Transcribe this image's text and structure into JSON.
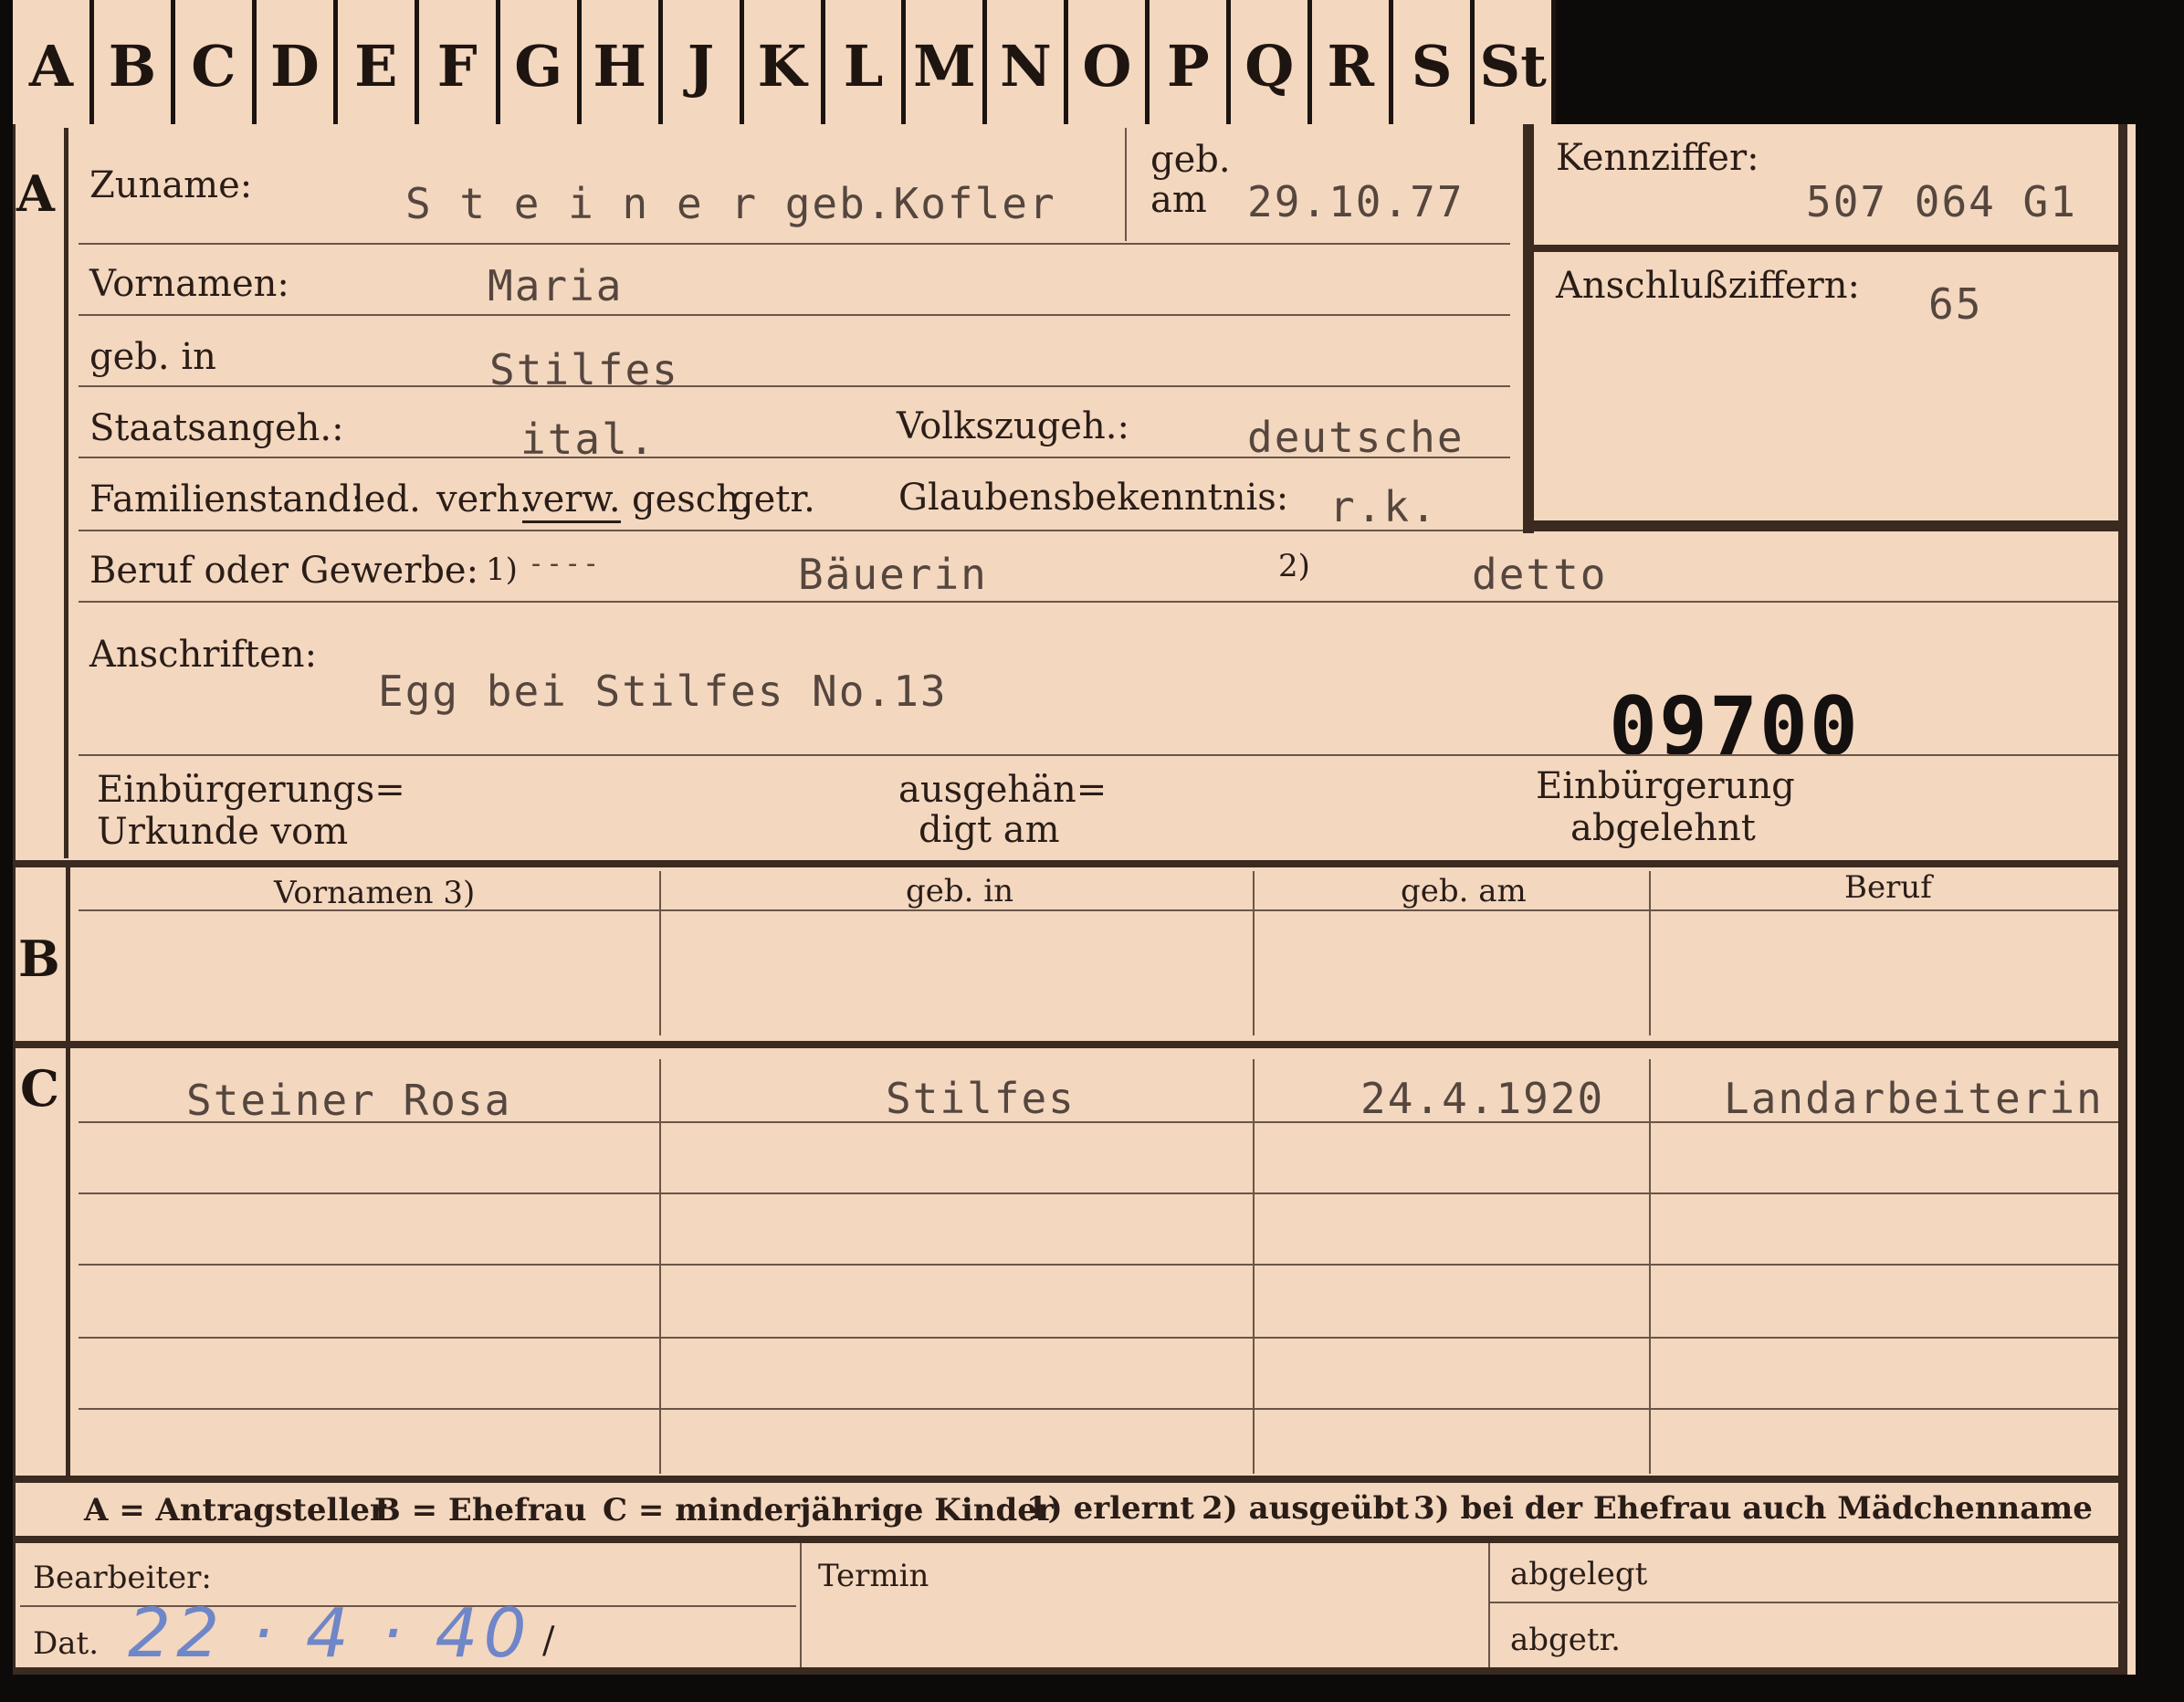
{
  "index_tabs": [
    "A",
    "B",
    "C",
    "D",
    "E",
    "F",
    "G",
    "H",
    "J",
    "K",
    "L",
    "M",
    "N",
    "O",
    "P",
    "Q",
    "R",
    "S",
    "St"
  ],
  "section_a": {
    "marker": "A",
    "surname_label": "Zuname:",
    "surname_value": "S t e i n e r  geb.Kofler",
    "born_label_1": "geb.",
    "born_label_2": "am",
    "born_value": "29.10.77",
    "id_label": "Kennziffer:",
    "id_value": "507 064  G1",
    "link_label": "Anschlußziffern:",
    "link_value": "65",
    "first_names_label": "Vornamen:",
    "first_names_value": "Maria",
    "birthplace_label": "geb. in",
    "birthplace_value": "Stilfes",
    "citizenship_label": "Staatsangeh.:",
    "citizenship_value": "ital.",
    "ethnicity_label": "Volkszugeh.:",
    "ethnicity_value": "deutsche",
    "marital_label": "Familienstand:",
    "marital_options": [
      "led.",
      "verh.",
      "verw.",
      "gesch.",
      "getr."
    ],
    "religion_label": "Glaubensbekenntnis:",
    "religion_value": "r.k.",
    "profession_label": "Beruf oder Gewerbe:",
    "profession_learned_mark": "1)",
    "profession_learned_dash": "----",
    "profession_learned_value": "Bäuerin",
    "profession_practiced_mark": "2)",
    "profession_practiced_value": "detto",
    "address_label": "Anschriften:",
    "address_value": "Egg bei Stilfes No.13",
    "stamp_number": "09700",
    "naturalization_cert_label_1": "Einbürgerungs=",
    "naturalization_cert_label_2": "Urkunde vom",
    "handed_label_1": "ausgehän=",
    "handed_label_2": "digt am",
    "naturalization_denied_label_1": "Einbürgerung",
    "naturalization_denied_label_2": "abgelehnt"
  },
  "section_b": {
    "marker": "B",
    "columns": [
      "Vornamen 3)",
      "geb. in",
      "geb. am",
      "Beruf"
    ]
  },
  "section_c": {
    "marker": "C",
    "rows": [
      {
        "name": "Steiner Rosa",
        "birthplace": "Stilfes",
        "birthdate": "24.4.1920",
        "profession": "Landarbeiterin"
      }
    ]
  },
  "legend": {
    "a": "A = Antragsteller",
    "b": "B = Ehefrau",
    "c": "C = minderjährige Kinder",
    "n1": "1) erlernt",
    "n2": "2) ausgeübt",
    "n3": "3) bei der Ehefrau auch Mädchenname"
  },
  "footer": {
    "clerk_label": "Bearbeiter:",
    "date_label": "Dat.",
    "date_handwritten": "22 · 4 · 40",
    "date_slash": "/",
    "deadline_label": "Termin",
    "filed_label": "abgelegt",
    "separated_label": "abgetr."
  }
}
